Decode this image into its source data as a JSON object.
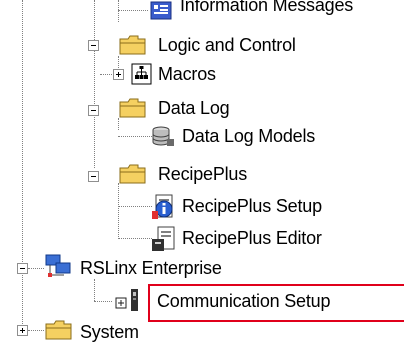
{
  "tree": {
    "items": [
      {
        "label": "Information Messages",
        "icon": "information-messages-icon"
      },
      {
        "label": "Logic and Control",
        "icon": "folder-icon",
        "toggle": "expanded"
      },
      {
        "label": "Macros",
        "icon": "macros-icon",
        "toggle": "collapsed"
      },
      {
        "label": "Data Log",
        "icon": "folder-icon",
        "toggle": "expanded"
      },
      {
        "label": "Data Log Models",
        "icon": "database-icon"
      },
      {
        "label": "RecipePlus",
        "icon": "folder-icon",
        "toggle": "expanded"
      },
      {
        "label": "RecipePlus Setup",
        "icon": "recipe-setup-icon"
      },
      {
        "label": "RecipePlus Editor",
        "icon": "recipe-editor-icon"
      },
      {
        "label": "RSLinx Enterprise",
        "icon": "network-icon",
        "toggle": "expanded"
      },
      {
        "label": "Communication Setup",
        "icon": "communication-setup-icon",
        "selected": true
      },
      {
        "label": "System",
        "icon": "folder-icon",
        "toggle": "collapsed"
      }
    ]
  },
  "colors": {
    "highlight_border": "#e0001b",
    "folder": "#f5d061",
    "tree_lines": "#808080"
  }
}
